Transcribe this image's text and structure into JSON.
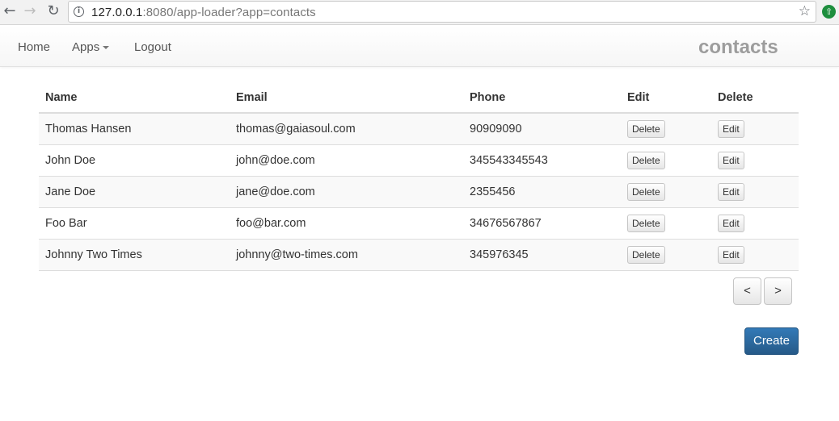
{
  "browser": {
    "url_host": "127.0.0.1",
    "url_rest": ":8080/app-loader?app=contacts"
  },
  "navbar": {
    "home_label": "Home",
    "apps_label": "Apps",
    "logout_label": "Logout",
    "brand": "contacts"
  },
  "table": {
    "headers": {
      "name": "Name",
      "email": "Email",
      "phone": "Phone",
      "edit": "Edit",
      "delete": "Delete"
    },
    "rows": [
      {
        "name": "Thomas Hansen",
        "email": "thomas@gaiasoul.com",
        "phone": "90909090",
        "delete_label": "Delete",
        "edit_label": "Edit"
      },
      {
        "name": "John Doe",
        "email": "john@doe.com",
        "phone": "345543345543",
        "delete_label": "Delete",
        "edit_label": "Edit"
      },
      {
        "name": "Jane Doe",
        "email": "jane@doe.com",
        "phone": "2355456",
        "delete_label": "Delete",
        "edit_label": "Edit"
      },
      {
        "name": "Foo Bar",
        "email": "foo@bar.com",
        "phone": "34676567867",
        "delete_label": "Delete",
        "edit_label": "Edit"
      },
      {
        "name": "Johnny Two Times",
        "email": "johnny@two-times.com",
        "phone": "345976345",
        "delete_label": "Delete",
        "edit_label": "Edit"
      }
    ]
  },
  "pager": {
    "prev_label": "<",
    "next_label": ">"
  },
  "create_label": "Create",
  "colors": {
    "primary": "#337ab7",
    "brand_text": "#9d9d9d"
  }
}
